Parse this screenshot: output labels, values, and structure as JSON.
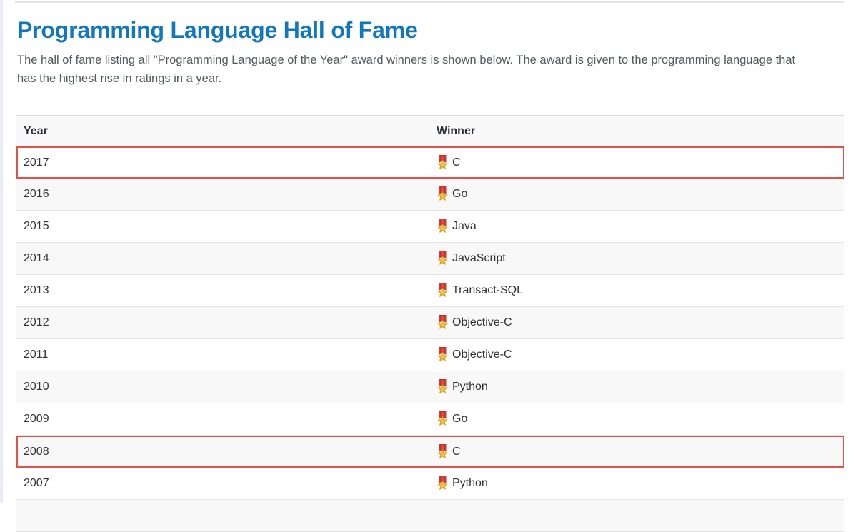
{
  "page": {
    "title": "Programming Language Hall of Fame",
    "description_line1": "The hall of fame listing all \"Programming Language of the Year\" award winners is shown below. The award is given to the programming language that",
    "description_line2": "has the highest rise in ratings in a year.",
    "title_color": "#1277bd",
    "text_color": "#333333",
    "description_color": "#555a5e",
    "highlight_border_color": "#e0524c",
    "stripe_color": "#f8f8f8"
  },
  "table": {
    "columns": [
      "Year",
      "Winner"
    ],
    "winner_icon": "military-medal-icon",
    "rows": [
      {
        "year": "2017",
        "winner": "C",
        "highlighted": true
      },
      {
        "year": "2016",
        "winner": "Go",
        "highlighted": false
      },
      {
        "year": "2015",
        "winner": "Java",
        "highlighted": false
      },
      {
        "year": "2014",
        "winner": "JavaScript",
        "highlighted": false
      },
      {
        "year": "2013",
        "winner": "Transact-SQL",
        "highlighted": false
      },
      {
        "year": "2012",
        "winner": "Objective-C",
        "highlighted": false
      },
      {
        "year": "2011",
        "winner": "Objective-C",
        "highlighted": false
      },
      {
        "year": "2010",
        "winner": "Python",
        "highlighted": false
      },
      {
        "year": "2009",
        "winner": "Go",
        "highlighted": false
      },
      {
        "year": "2008",
        "winner": "C",
        "highlighted": true
      },
      {
        "year": "2007",
        "winner": "Python",
        "highlighted": false
      }
    ]
  }
}
